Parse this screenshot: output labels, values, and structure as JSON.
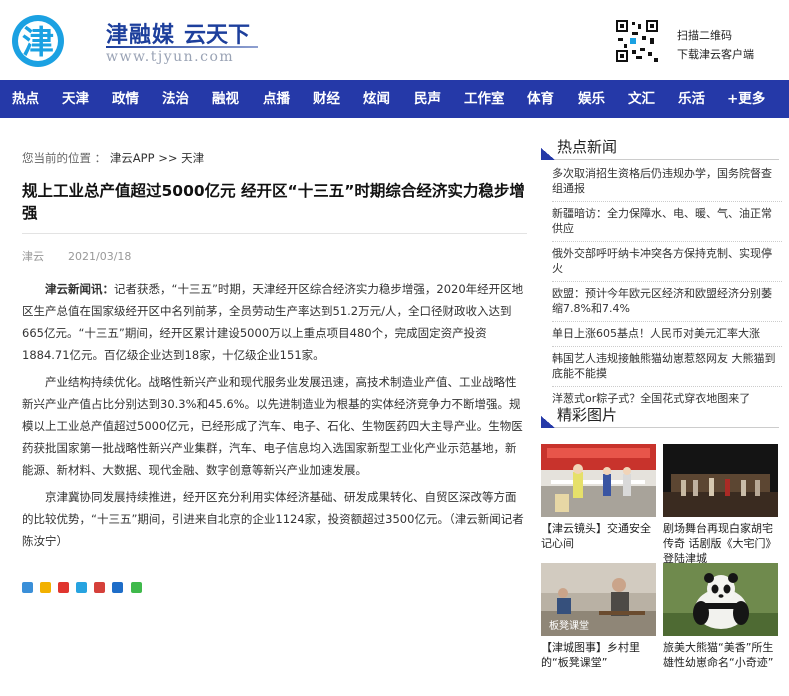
{
  "header": {
    "brand_name": "津融媒",
    "brand_slogan": "云天下",
    "brand_url": "www.tjyun.com",
    "qr_line1": "扫描二维码",
    "qr_line2": "下载津云客户端",
    "brand_color": "#1d3f9c",
    "logo_color": "#1ba1e2"
  },
  "nav": {
    "items": [
      "热点",
      "天津",
      "政情",
      "法治",
      "融视",
      "点播",
      "财经",
      "炫闻",
      "民声",
      "工作室",
      "体育",
      "娱乐",
      "文汇",
      "乐活",
      "+更多"
    ],
    "bg_color": "#2539a8"
  },
  "breadcrumb": {
    "prefix": "您当前的位置 ：",
    "path": "津云APP >> 天津"
  },
  "article": {
    "title": "规上工业总产值超过5000亿元 经开区“十三五”时期综合经济实力稳步增强",
    "source": "津云",
    "date": "2021/03/18",
    "lead_prefix": "津云新闻讯：",
    "lead_text": "记者获悉，“十三五”时期，天津经开区综合经济实力稳步增强，2020年经开区地区生产总值在国家级经开区中名列前茅，全员劳动生产率达到51.2万元/人，全口径财政收入达到665亿元。“十三五”期间，经开区累计建设5000万以上重点项目480个，完成固定资产投资1884.71亿元。百亿级企业达到18家，十亿级企业151家。",
    "para2": "产业结构持续优化。战略性新兴产业和现代服务业发展迅速，高技术制造业产值、工业战略性新兴产业产值占比分别达到30.3%和45.6%。以先进制造业为根基的实体经济竞争力不断增强。规模以上工业总产值超过5000亿元，已经形成了汽车、电子、石化、生物医药四大主导产业。生物医药获批国家第一批战略性新兴产业集群，汽车、电子信息均入选国家新型工业化产业示范基地，新能源、新材料、大数据、现代金融、数字创意等新兴产业加速发展。",
    "para3": "京津冀协同发展持续推进，经开区充分利用实体经济基础、研发成果转化、自贸区深改等方面的比较优势，“十三五”期间，引进来自北京的企业1124家，投资额超过3500亿元。（津云新闻记者 陈汝宁）"
  },
  "share": {
    "icons": [
      "qzone-icon",
      "wechat-moments-icon",
      "weibo-icon",
      "tencent-weibo-icon",
      "douban-icon",
      "renren-icon",
      "wechat-icon"
    ]
  },
  "sidebar": {
    "hot_title": "热点新闻",
    "hot_items": [
      "多次取消招生资格后仍违规办学，国务院督查组通报",
      "新疆暗访：全力保障水、电、暖、气、油正常供应",
      "俄外交部呼吁纳卡冲突各方保持克制、实现停火",
      "欧盟：预计今年欧元区经济和欧盟经济分别萎缩7.8%和7.4%",
      "单日上涨605基点！人民币对美元汇率大涨",
      "韩国艺人违规接触熊猫幼崽惹怒网友 大熊猫到底能不能摸",
      "洋葱式or粽子式？全国花式穿衣地图来了"
    ],
    "pic_title": "精彩图片",
    "pics": [
      {
        "caption": "【津云镜头】交通安全记心间"
      },
      {
        "caption": "剧场舞台再现白家胡宅传奇 话剧版《大宅门》登陆津城"
      },
      {
        "caption": "【津城图事】乡村里的“板凳课堂”"
      },
      {
        "caption": "旅美大熊猫“美香”所生雄性幼崽命名“小奇迹”"
      }
    ],
    "pic3_overlay": "板凳课堂"
  }
}
